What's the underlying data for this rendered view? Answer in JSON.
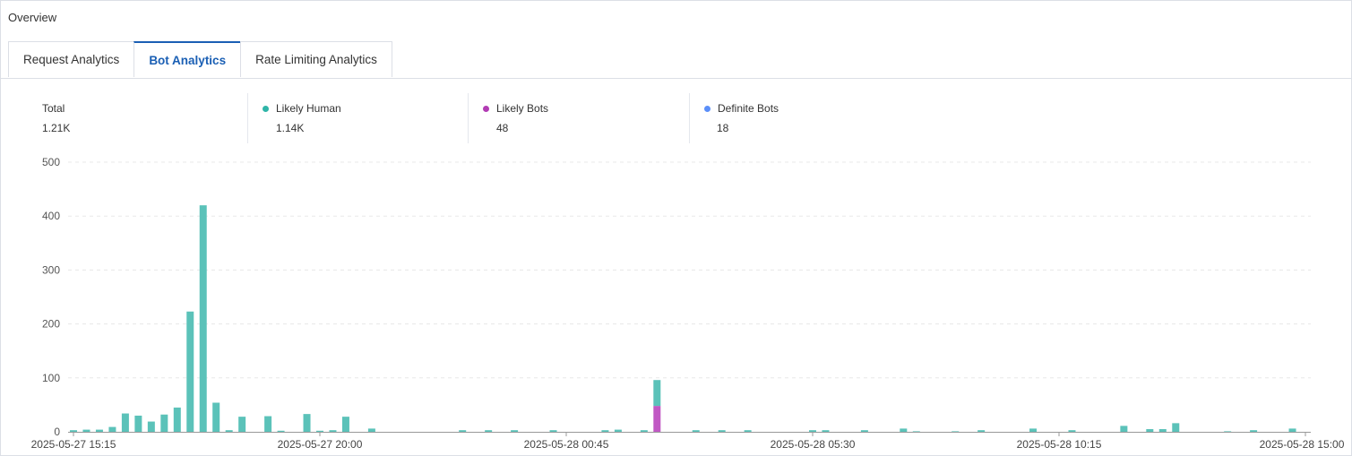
{
  "header": {
    "title": "Overview"
  },
  "tabs": [
    {
      "label": "Request Analytics",
      "active": false
    },
    {
      "label": "Bot Analytics",
      "active": true
    },
    {
      "label": "Rate Limiting Analytics",
      "active": false
    }
  ],
  "stats": {
    "total": {
      "label": "Total",
      "value": "1.21K"
    },
    "human": {
      "label": "Likely Human",
      "value": "1.14K",
      "color": "#2fb5a8"
    },
    "likely_bots": {
      "label": "Likely Bots",
      "value": "48",
      "color": "#b23cb4"
    },
    "definite_bots": {
      "label": "Definite Bots",
      "value": "18",
      "color": "#5b8ff9"
    }
  },
  "colors": {
    "human": "#5bc2b9",
    "likely_bots": "#c158c4",
    "definite_bots": "#5b8ff9",
    "grid": "#e8e8e8"
  },
  "chart_data": {
    "type": "bar",
    "stacked": true,
    "ylim": [
      0,
      500
    ],
    "yticks": [
      0,
      100,
      200,
      300,
      400,
      500
    ],
    "grid": true,
    "x_labels": [
      "2025-05-27 15:15",
      "2025-05-27 20:00",
      "2025-05-28 00:45",
      "2025-05-28 05:30",
      "2025-05-28 10:15",
      "2025-05-28 15:00"
    ],
    "x_label_slots": [
      0,
      19,
      38,
      57,
      76,
      95
    ],
    "slots": 96,
    "series": [
      {
        "name": "Likely Human",
        "points": [
          [
            0,
            3
          ],
          [
            1,
            4
          ],
          [
            2,
            4
          ],
          [
            3,
            9
          ],
          [
            4,
            34
          ],
          [
            5,
            30
          ],
          [
            6,
            19
          ],
          [
            7,
            32
          ],
          [
            8,
            45
          ],
          [
            9,
            223
          ],
          [
            10,
            420
          ],
          [
            11,
            54
          ],
          [
            12,
            3
          ],
          [
            13,
            28
          ],
          [
            15,
            29
          ],
          [
            16,
            2
          ],
          [
            18,
            33
          ],
          [
            19,
            2
          ],
          [
            20,
            3
          ],
          [
            21,
            28
          ],
          [
            23,
            6
          ],
          [
            30,
            3
          ],
          [
            32,
            3
          ],
          [
            34,
            3
          ],
          [
            37,
            3
          ],
          [
            41,
            3
          ],
          [
            42,
            4
          ],
          [
            44,
            3
          ],
          [
            45,
            48
          ],
          [
            48,
            3
          ],
          [
            50,
            3
          ],
          [
            52,
            3
          ],
          [
            57,
            3
          ],
          [
            58,
            3
          ],
          [
            61,
            3
          ],
          [
            64,
            6
          ],
          [
            65,
            1
          ],
          [
            68,
            1
          ],
          [
            70,
            3
          ],
          [
            74,
            6
          ],
          [
            77,
            3
          ],
          [
            81,
            11
          ],
          [
            83,
            5
          ],
          [
            84,
            5
          ],
          [
            85,
            16
          ],
          [
            89,
            1
          ],
          [
            91,
            3
          ],
          [
            94,
            6
          ]
        ]
      },
      {
        "name": "Likely Bots",
        "points": [
          [
            45,
            48
          ]
        ]
      },
      {
        "name": "Definite Bots",
        "points": []
      }
    ]
  }
}
